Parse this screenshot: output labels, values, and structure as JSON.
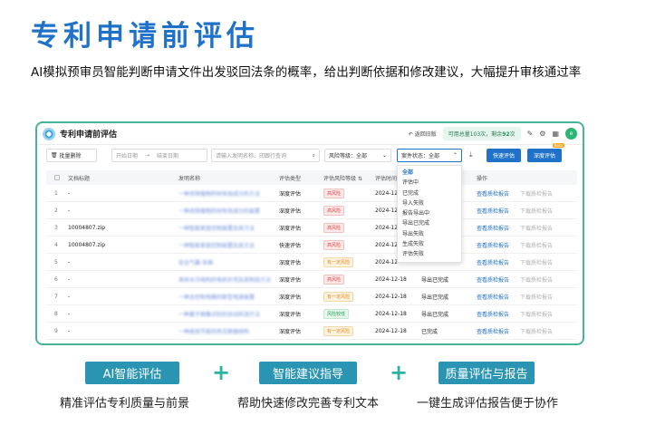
{
  "hero": {
    "title": "专利申请前评估",
    "description": "AI模拟预审员智能判断申请文件出发驳回法条的概率，给出判断依据和修改建议，大幅提升审核通过率"
  },
  "app": {
    "title": "专利申请前评估",
    "back_label": "返回旧版",
    "quota_label": "可用总量103次，剩余",
    "quota_remaining": "92",
    "quota_unit": "次",
    "avatar_text": "e"
  },
  "toolbar": {
    "bulk_delete": "批量删除",
    "start_date_placeholder": "开始日期",
    "date_sep": "→",
    "end_date_placeholder": "结束日期",
    "search_placeholder": "请输入发明名称、印跟行查询",
    "risk_level": "风险等级：全部",
    "case_status": "案件状态：全部",
    "quick_eval": "快速评估",
    "deep_eval": "深度评估",
    "beta": "Beta"
  },
  "table": {
    "headers": [
      "",
      "文档标题",
      "发明名称",
      "评估类型",
      "评估风险等级",
      "评估时间",
      "",
      "操作",
      ""
    ],
    "rows": [
      {
        "no": "1",
        "doc": "-",
        "name": "一种去除植物药材有效成分的方法",
        "type": "深度评估",
        "risk": "高风险",
        "risk_class": "high",
        "time": "2024-12-",
        "status": "",
        "view": "查看质检报告",
        "download": "下载质检报告"
      },
      {
        "no": "2",
        "doc": "-",
        "name": "一种去除植物药材有效成分的装置",
        "type": "深度评估",
        "risk": "高风险",
        "risk_class": "high",
        "time": "2024-12-",
        "status": "",
        "view": "查看质检报告",
        "download": "下载质检报告"
      },
      {
        "no": "3",
        "doc": "10004807.zip",
        "name": "一种智能家居控制装置及其方法",
        "type": "深度评估",
        "risk": "高风险",
        "risk_class": "high",
        "time": "2024-12-",
        "status": "",
        "view": "查看质检报告",
        "download": "下载质检报告"
      },
      {
        "no": "4",
        "doc": "10004807.zip",
        "name": "一种智能家居控制装置及其方法",
        "type": "快速评估",
        "risk": "高风险",
        "risk_class": "high",
        "time": "2024-12-",
        "status": "",
        "view": "查看质检报告",
        "download": "下载质检报告"
      },
      {
        "no": "5",
        "doc": "-",
        "name": "安全气囊-车辆",
        "type": "深度评估",
        "risk": "有一定风险",
        "risk_class": "mid",
        "time": "2024-12-",
        "status": "",
        "view": "查看质检报告",
        "download": "下载质检报告"
      },
      {
        "no": "6",
        "doc": "-",
        "name": "具有水冷结构的电机外壳及其制造方法",
        "type": "深度评估",
        "risk": "高风险",
        "risk_class": "high",
        "time": "2024-12-18",
        "status": "导出已完成",
        "view": "查看质检报告",
        "download": "下载质检报告"
      },
      {
        "no": "7",
        "doc": "-",
        "name": "一种全控制电路的新型电源装置",
        "type": "深度评估",
        "risk": "有一定风险",
        "risk_class": "mid",
        "time": "2024-12-18",
        "status": "导出已完成",
        "view": "查看质检报告",
        "download": "下载质检报告"
      },
      {
        "no": "8",
        "doc": "-",
        "name": "一种基于图像识别的自动检测方法",
        "type": "深度评估",
        "risk": "风险较低",
        "risk_class": "low",
        "time": "2024-12-18",
        "status": "导出已完成",
        "view": "查看质检报告",
        "download": "下载质检报告"
      },
      {
        "no": "9",
        "doc": "-",
        "name": "一种高效节能的热交换器结构",
        "type": "深度评估",
        "risk": "有一定风险",
        "risk_class": "mid",
        "time": "2024-12-18",
        "status": "已完成",
        "view": "查看质检报告",
        "download": "下载质检报告"
      }
    ]
  },
  "status_dropdown": {
    "options": [
      "全部",
      "评估中",
      "已完成",
      "导入失败",
      "报告导出中",
      "导出已完成",
      "导出失败",
      "生成失败",
      "评估失败"
    ],
    "selected": 0
  },
  "features": [
    {
      "label": "AI智能评估",
      "desc": "精准评估专利质量与前景"
    },
    {
      "label": "智能建议指导",
      "desc": "帮助快速修改完善专利文本"
    },
    {
      "label": "质量评估与报告",
      "desc": "一键生成评估报告便于协作"
    }
  ],
  "plus_sign": "+",
  "icons": [
    "back-icon",
    "edit-icon",
    "settings-icon",
    "apps-grid-icon",
    "search-icon",
    "download-icon",
    "chevron-down-icon",
    "trash-icon",
    "sort-icon"
  ],
  "colors": {
    "brand": "#1f72c8",
    "frame_border": "#46b59a",
    "feature_bg": "#2a95b3",
    "plus": "#2cb3a4"
  }
}
